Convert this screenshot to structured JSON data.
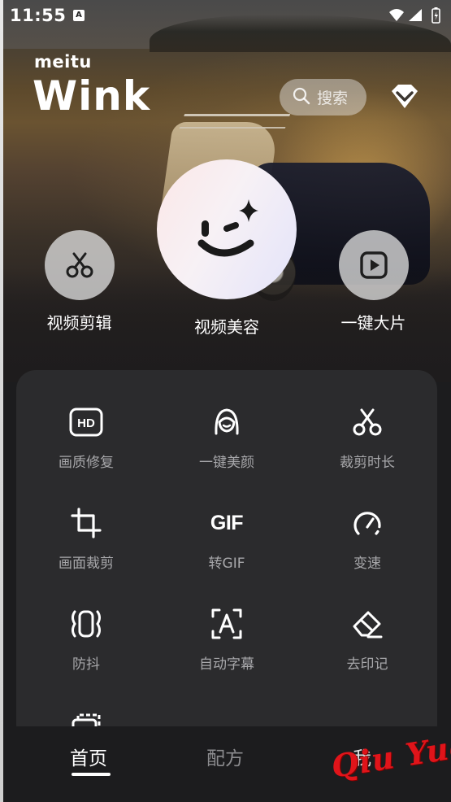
{
  "status_bar": {
    "time": "11:55",
    "notification_badge": "A"
  },
  "header": {
    "brand_small": "meitu",
    "brand_big": "Wink",
    "search_placeholder": "搜索",
    "search_icon": "search-icon",
    "vip_icon": "diamond-icon"
  },
  "features": [
    {
      "label": "视频剪辑",
      "icon": "scissors-icon"
    },
    {
      "label": "视频美容",
      "icon": "wink-face-icon"
    },
    {
      "label": "一键大片",
      "icon": "play-icon"
    }
  ],
  "tools": [
    {
      "label": "画质修复",
      "icon": "hd-icon"
    },
    {
      "label": "一键美颜",
      "icon": "face-beauty-icon"
    },
    {
      "label": "裁剪时长",
      "icon": "scissors-icon"
    },
    {
      "label": "画面裁剪",
      "icon": "crop-icon"
    },
    {
      "label": "转GIF",
      "icon": "gif-icon",
      "icon_text": "GIF"
    },
    {
      "label": "变速",
      "icon": "speed-gauge-icon"
    },
    {
      "label": "防抖",
      "icon": "stabilize-icon"
    },
    {
      "label": "自动字幕",
      "icon": "auto-caption-icon"
    },
    {
      "label": "去印记",
      "icon": "eraser-icon"
    },
    {
      "label": "",
      "icon": "layers-icon"
    }
  ],
  "bottom_nav": {
    "tabs": [
      {
        "label": "首页",
        "active": true
      },
      {
        "label": "配方",
        "active": false
      },
      {
        "label": "我",
        "active": false
      }
    ]
  },
  "watermark": {
    "text": "Qiu Yue",
    "color": "#e0141a"
  },
  "colors": {
    "panel_bg": "#2b2b2d",
    "label_gray": "#a7a7aa",
    "app_bg": "#1c1c1e"
  }
}
